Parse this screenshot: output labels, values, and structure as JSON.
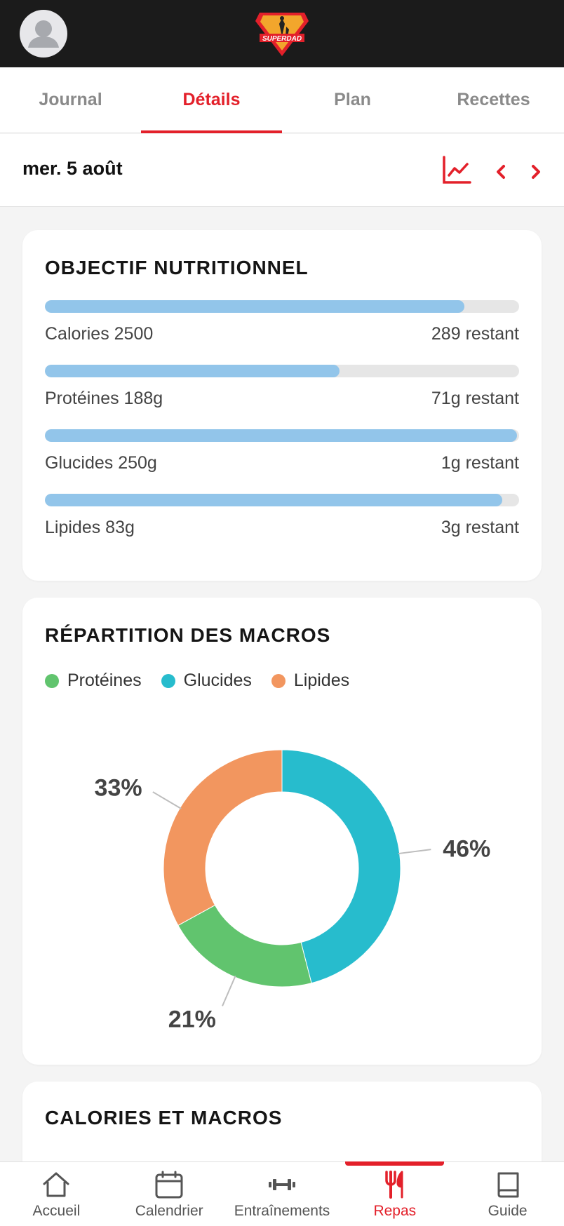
{
  "header": {
    "logo_text": "SUPERDAD"
  },
  "tabs": [
    {
      "label": "Journal",
      "active": false
    },
    {
      "label": "Détails",
      "active": true
    },
    {
      "label": "Plan",
      "active": false
    },
    {
      "label": "Recettes",
      "active": false
    }
  ],
  "datebar": {
    "date": "mer. 5 août"
  },
  "nutrition": {
    "title": "OBJECTIF NUTRITIONNEL",
    "items": [
      {
        "label": "Calories 2500",
        "remaining": "289 restant",
        "progress": 0.884
      },
      {
        "label": "Protéines 188g",
        "remaining": "71g restant",
        "progress": 0.622
      },
      {
        "label": "Glucides 250g",
        "remaining": "1g restant",
        "progress": 0.996
      },
      {
        "label": "Lipides 83g",
        "remaining": "3g restant",
        "progress": 0.964
      }
    ]
  },
  "macros": {
    "title": "RÉPARTITION DES MACROS",
    "chart_data": {
      "type": "pie",
      "title": "",
      "categories": [
        "Protéines",
        "Glucides",
        "Lipides"
      ],
      "values": [
        21,
        46,
        33
      ],
      "labels": [
        "21%",
        "46%",
        "33%"
      ],
      "colors": [
        "#61c46e",
        "#27bccd",
        "#f2965f"
      ],
      "legend": "top-left"
    }
  },
  "calories_macros": {
    "title": "CALORIES ET MACROS"
  },
  "nav": [
    {
      "label": "Accueil",
      "icon": "home-icon",
      "active": false
    },
    {
      "label": "Calendrier",
      "icon": "calendar-icon",
      "active": false
    },
    {
      "label": "Entraînements",
      "icon": "dumbbell-icon",
      "active": false
    },
    {
      "label": "Repas",
      "icon": "utensils-icon",
      "active": true
    },
    {
      "label": "Guide",
      "icon": "book-icon",
      "active": false
    }
  ],
  "colors": {
    "accent": "#e3202a",
    "bar_fill": "#92c5ea",
    "bar_track": "#e6e6e6"
  }
}
